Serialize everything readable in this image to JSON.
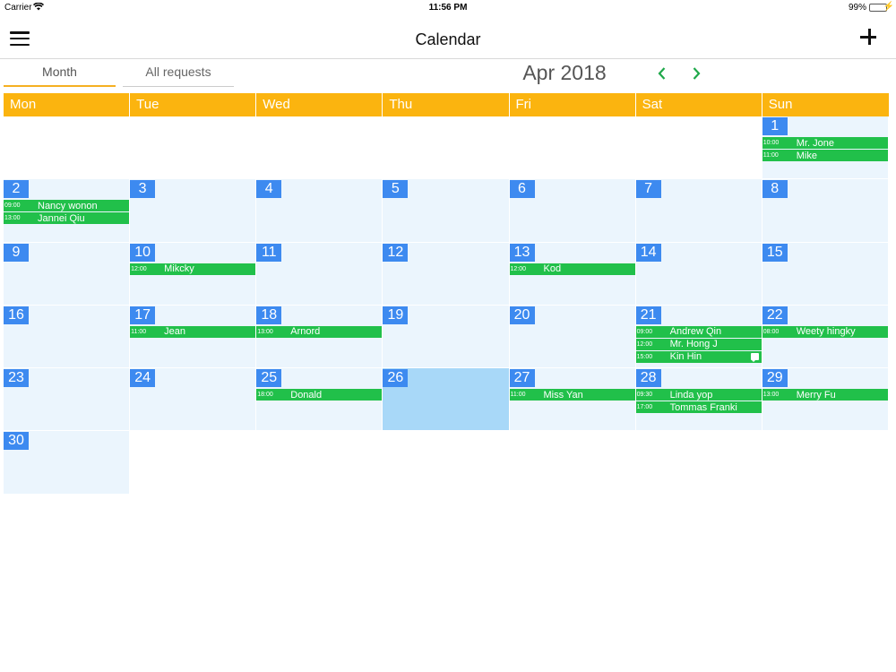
{
  "status_bar": {
    "carrier": "Carrier",
    "time": "11:56 PM",
    "battery": "99%"
  },
  "nav": {
    "title": "Calendar"
  },
  "tabs": [
    {
      "label": "Month"
    },
    {
      "label": "All requests"
    }
  ],
  "month_label": "Apr 2018",
  "weekdays": [
    "Mon",
    "Tue",
    "Wed",
    "Thu",
    "Fri",
    "Sat",
    "Sun"
  ],
  "colors": {
    "header": "#fbb40f",
    "day_badge": "#3d8af0",
    "event": "#21c04a",
    "cell": "#ebf5fd",
    "today": "#a8d8f8",
    "nav_arrows": "#1fa84a"
  },
  "weeks": [
    [
      {
        "day": null
      },
      {
        "day": null
      },
      {
        "day": null
      },
      {
        "day": null
      },
      {
        "day": null
      },
      {
        "day": null
      },
      {
        "day": "1",
        "events": [
          {
            "time": "10:00",
            "name": "Mr. Jone"
          },
          {
            "time": "11:00",
            "name": "Mike"
          }
        ]
      }
    ],
    [
      {
        "day": "2",
        "events": [
          {
            "time": "09:00",
            "name": "Nancy wonon"
          },
          {
            "time": "13:00",
            "name": "Jannei Qiu"
          }
        ]
      },
      {
        "day": "3",
        "events": []
      },
      {
        "day": "4",
        "events": []
      },
      {
        "day": "5",
        "events": []
      },
      {
        "day": "6",
        "events": []
      },
      {
        "day": "7",
        "events": []
      },
      {
        "day": "8",
        "events": []
      }
    ],
    [
      {
        "day": "9",
        "events": []
      },
      {
        "day": "10",
        "events": [
          {
            "time": "12:00",
            "name": "Mikcky"
          }
        ]
      },
      {
        "day": "11",
        "events": []
      },
      {
        "day": "12",
        "events": []
      },
      {
        "day": "13",
        "events": [
          {
            "time": "12:00",
            "name": "Kod"
          }
        ]
      },
      {
        "day": "14",
        "events": []
      },
      {
        "day": "15",
        "events": []
      }
    ],
    [
      {
        "day": "16",
        "events": []
      },
      {
        "day": "17",
        "events": [
          {
            "time": "11:00",
            "name": "Jean"
          }
        ]
      },
      {
        "day": "18",
        "events": [
          {
            "time": "13:00",
            "name": "Arnord"
          }
        ]
      },
      {
        "day": "19",
        "events": []
      },
      {
        "day": "20",
        "events": []
      },
      {
        "day": "21",
        "events": [
          {
            "time": "09:00",
            "name": "Andrew Qin"
          },
          {
            "time": "12:00",
            "name": "Mr. Hong J"
          },
          {
            "time": "15:00",
            "name": "Kin Hin",
            "message": true
          }
        ]
      },
      {
        "day": "22",
        "events": [
          {
            "time": "08:00",
            "name": "Weety hingky"
          }
        ]
      }
    ],
    [
      {
        "day": "23",
        "events": []
      },
      {
        "day": "24",
        "events": []
      },
      {
        "day": "25",
        "events": [
          {
            "time": "18:00",
            "name": "Donald"
          }
        ]
      },
      {
        "day": "26",
        "events": [],
        "today": true
      },
      {
        "day": "27",
        "events": [
          {
            "time": "11:00",
            "name": "Miss Yan"
          }
        ]
      },
      {
        "day": "28",
        "events": [
          {
            "time": "09:30",
            "name": "Linda yop"
          },
          {
            "time": "17:00",
            "name": "Tommas Franki"
          }
        ]
      },
      {
        "day": "29",
        "events": [
          {
            "time": "13:00",
            "name": "Merry Fu"
          }
        ]
      }
    ],
    [
      {
        "day": "30",
        "events": []
      },
      {
        "day": null
      },
      {
        "day": null
      },
      {
        "day": null
      },
      {
        "day": null
      },
      {
        "day": null
      },
      {
        "day": null
      }
    ]
  ]
}
